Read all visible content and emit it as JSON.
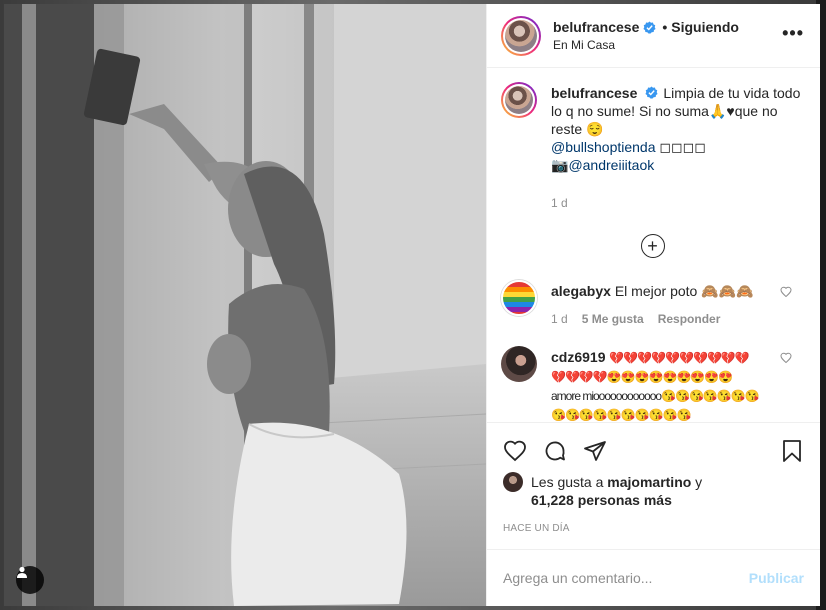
{
  "header": {
    "username": "belufrancese",
    "follow_status": "Siguiendo",
    "location": "En Mi Casa",
    "more_glyph": "•••"
  },
  "caption": {
    "username": "belufrancese",
    "text": "Limpia de tu vida todo lo q no sume! Si no suma🙏♥que no reste 😌",
    "mention1": "@bullshoptienda",
    "mention1_suffix": " ◻◻◻◻",
    "camera_emoji": "📷",
    "mention2": "@andreiiitaok",
    "time": "1 d"
  },
  "load_more_glyph": "+",
  "comments": [
    {
      "username": "alegabyx",
      "text": "El mejor poto 🙈🙈🙈",
      "time": "1 d",
      "likes": "5 Me gusta",
      "reply": "Responder"
    },
    {
      "username": "cdz6919",
      "text": "💔💔💔💔💔💔💔💔💔💔💔💔💔💔😍😍😍😍😍😍😍😍😍amore mioooooooooooo😘😘😘😘😘😘😘😘😘😘😘😘😘😘😘😘😘"
    }
  ],
  "likes": {
    "prefix": "Les gusta a ",
    "liker": "majomartino",
    "connector": " y",
    "count": "61,228 personas más"
  },
  "age": "Hace un día",
  "add_comment": {
    "placeholder": "Agrega un comentario...",
    "publish": "Publicar"
  },
  "colors": {
    "verified": "#3897f0",
    "link": "#00376b",
    "publish_disabled": "#b2dffc"
  }
}
